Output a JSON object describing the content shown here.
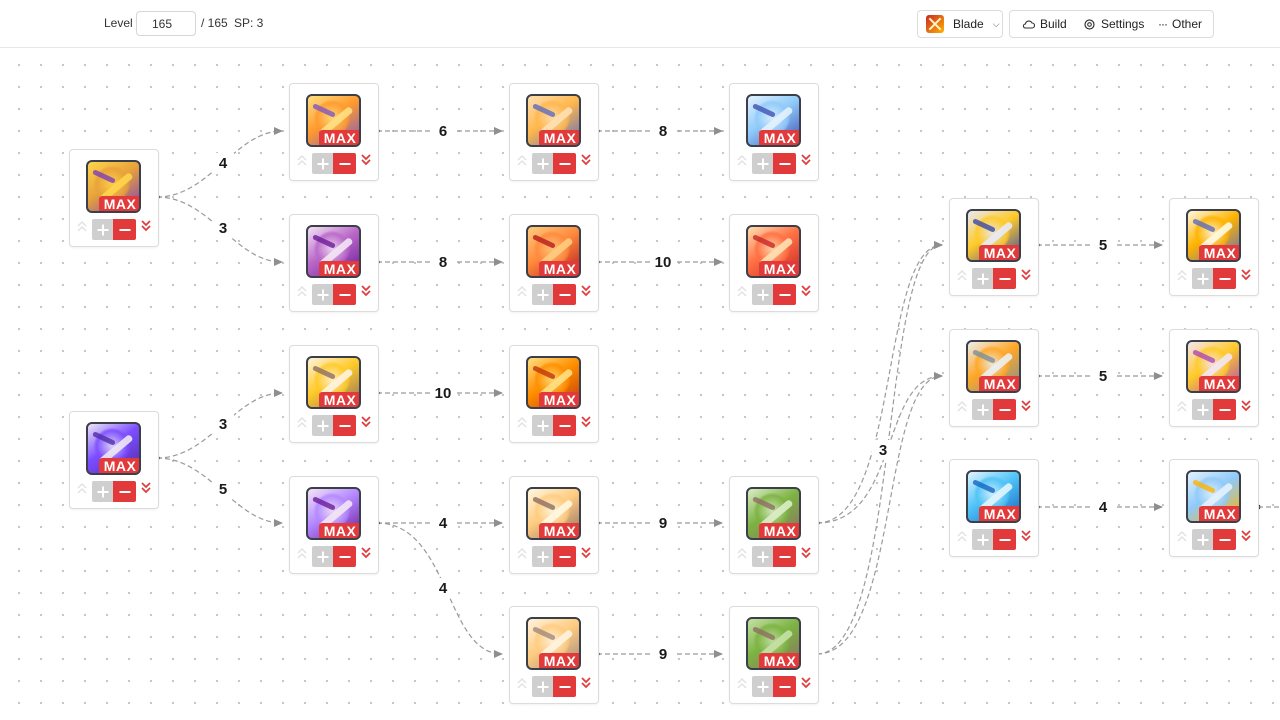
{
  "toolbar": {
    "level_label": "Level",
    "level_value": "165",
    "level_max": "/ 165",
    "sp": "SP: 3",
    "class_name": "Blade",
    "class_icon": "blade-class-icon",
    "build_label": "Build",
    "settings_label": "Settings",
    "other_label": "Other"
  },
  "skills": [
    {
      "id": "s1",
      "max": "MAX",
      "colors": [
        "#e8a23a",
        "#7b3fb8",
        "#ffd54a"
      ]
    },
    {
      "id": "s2",
      "max": "MAX",
      "colors": [
        "#ff9a2e",
        "#7e57c2",
        "#ffe082"
      ]
    },
    {
      "id": "s3",
      "max": "MAX",
      "colors": [
        "#ffb74d",
        "#5c6bc0",
        "#ffe0b2"
      ]
    },
    {
      "id": "s4",
      "max": "MAX",
      "colors": [
        "#90caf9",
        "#3f51b5",
        "#e3f2fd"
      ]
    },
    {
      "id": "s5",
      "max": "MAX",
      "colors": [
        "#ba68c8",
        "#6a1b9a",
        "#f3e5f5"
      ]
    },
    {
      "id": "s6",
      "max": "MAX",
      "colors": [
        "#ff8a3d",
        "#b71c1c",
        "#ffcc80"
      ]
    },
    {
      "id": "s7",
      "max": "MAX",
      "colors": [
        "#ff7043",
        "#c62828",
        "#ffe0b2"
      ]
    },
    {
      "id": "s8",
      "max": "MAX",
      "colors": [
        "#ffca28",
        "#8d6e63",
        "#fff3e0"
      ]
    },
    {
      "id": "s9",
      "max": "MAX",
      "colors": [
        "#ff8f00",
        "#bf360c",
        "#ffe082"
      ]
    },
    {
      "id": "s10",
      "max": "MAX",
      "colors": [
        "#7c4dff",
        "#512da8",
        "#ede7f6"
      ]
    },
    {
      "id": "s11",
      "max": "MAX",
      "colors": [
        "#b388ff",
        "#6a1b9a",
        "#f3e5f5"
      ]
    },
    {
      "id": "s12",
      "max": "MAX",
      "colors": [
        "#ffcc80",
        "#8d6e63",
        "#fff8e1"
      ]
    },
    {
      "id": "s13",
      "max": "MAX",
      "colors": [
        "#7cb342",
        "#8d6e63",
        "#dcedc8"
      ]
    },
    {
      "id": "s14",
      "max": "MAX",
      "colors": [
        "#ffcc80",
        "#a1887f",
        "#fff3e0"
      ]
    },
    {
      "id": "s15",
      "max": "MAX",
      "colors": [
        "#7cb342",
        "#8d6e63",
        "#c5e1a5"
      ]
    },
    {
      "id": "s16",
      "max": "MAX",
      "colors": [
        "#ffca28",
        "#3949ab",
        "#e8eaf6"
      ]
    },
    {
      "id": "s17",
      "max": "MAX",
      "colors": [
        "#ffb300",
        "#5c6bc0",
        "#fff8e1"
      ]
    },
    {
      "id": "s18",
      "max": "MAX",
      "colors": [
        "#ffa726",
        "#78909c",
        "#eceff1"
      ]
    },
    {
      "id": "s19",
      "max": "MAX",
      "colors": [
        "#ffca28",
        "#ab47bc",
        "#f3e5f5"
      ]
    },
    {
      "id": "s20",
      "max": "MAX",
      "colors": [
        "#4fc3f7",
        "#1565c0",
        "#e1f5fe"
      ]
    },
    {
      "id": "s21",
      "max": "MAX",
      "colors": [
        "#90caf9",
        "#ffb300",
        "#e3f2fd"
      ]
    }
  ],
  "links": [
    {
      "label": "4"
    },
    {
      "label": "3"
    },
    {
      "label": "6"
    },
    {
      "label": "8"
    },
    {
      "label": "8"
    },
    {
      "label": "10"
    },
    {
      "label": "3"
    },
    {
      "label": "5"
    },
    {
      "label": "10"
    },
    {
      "label": "4"
    },
    {
      "label": "9"
    },
    {
      "label": "4"
    },
    {
      "label": "9"
    },
    {
      "label": "3"
    },
    {
      "label": "5"
    },
    {
      "label": "5"
    },
    {
      "label": "4"
    }
  ]
}
